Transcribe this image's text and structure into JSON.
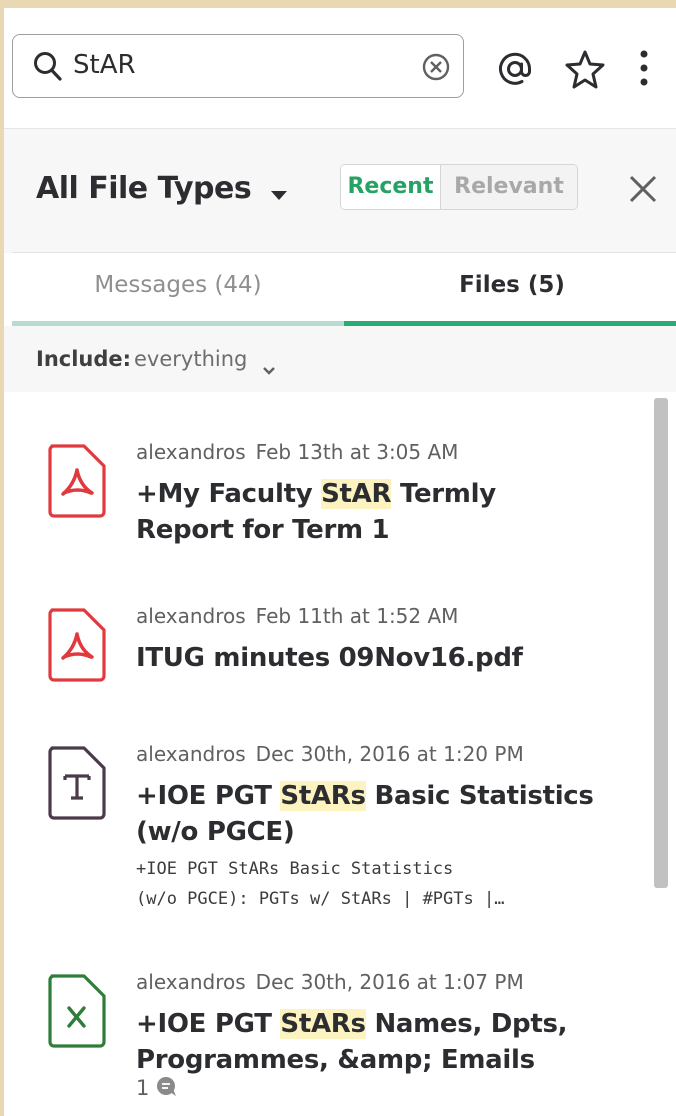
{
  "search": {
    "query": "StAR"
  },
  "header": {
    "file_types_label": "All File Types",
    "sort_recent": "Recent",
    "sort_relevant": "Relevant"
  },
  "tabs": {
    "messages": "Messages (44)",
    "files": "Files (5)",
    "active": "files"
  },
  "include": {
    "label": "Include:",
    "value": "everything"
  },
  "colors": {
    "accent_green": "#2bac76",
    "pdf_red": "#e0393e",
    "excel_green": "#2f7d3a",
    "text_icon": "#4b3a4a",
    "highlight": "#fcf3c1"
  },
  "results": [
    {
      "icon": "pdf-icon",
      "author": "alexandros",
      "date": "Feb 13th at 3:05 AM",
      "title_parts": [
        "+My Faculty ",
        "StAR",
        " Termly"
      ],
      "title_line2": "Report for Term 1"
    },
    {
      "icon": "pdf-icon",
      "author": "alexandros",
      "date": "Feb 11th at 1:52 AM",
      "title": "ITUG minutes 09Nov16.pdf"
    },
    {
      "icon": "text-file-icon",
      "author": "alexandros",
      "date": "Dec 30th, 2016 at 1:20 PM",
      "title_parts": [
        "+IOE PGT ",
        "StARs",
        " Basic Statistics"
      ],
      "title_line2": "(w/o PGCE)",
      "preview_line1": "+IOE PGT StARs Basic Statistics",
      "preview_line2": "(w/o PGCE): PGTs w/ StARs | #PGTs |…"
    },
    {
      "icon": "spreadsheet-icon",
      "author": "alexandros",
      "date": "Dec 30th, 2016 at 1:07 PM",
      "title_parts": [
        "+IOE PGT ",
        "StARs",
        " Names, Dpts,"
      ],
      "title_line2": "Programmes, &amp; Emails",
      "comment_count": "1"
    }
  ]
}
